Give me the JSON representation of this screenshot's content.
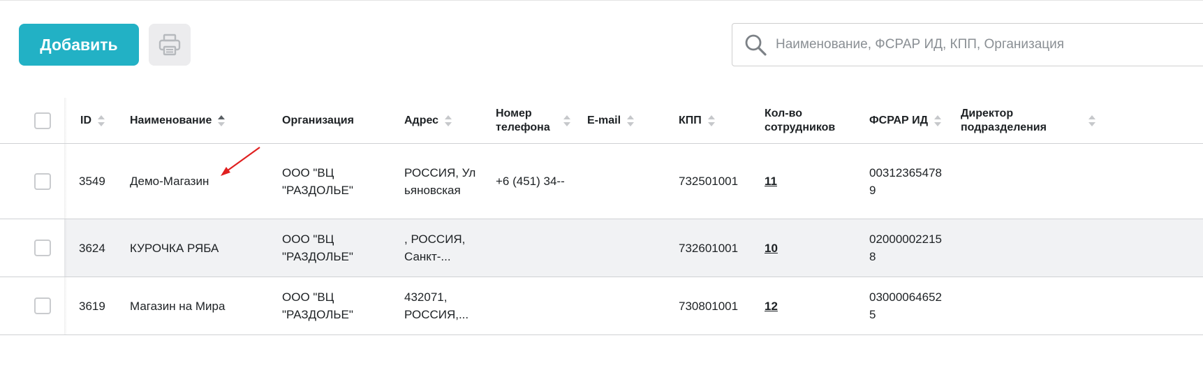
{
  "toolbar": {
    "add_label": "Добавить",
    "print_icon": "printer-icon",
    "search_icon": "search-icon",
    "search_placeholder": "Наименование, ФСРАР ИД, КПП, Организация",
    "search_value": ""
  },
  "colors": {
    "accent": "#22b1c5",
    "row_alt": "#f1f2f4",
    "annotation_arrow": "#e02020"
  },
  "table": {
    "columns": [
      {
        "label": "ID",
        "sort": "none"
      },
      {
        "label": "Наименование",
        "sort": "asc"
      },
      {
        "label": "Организация",
        "sort": ""
      },
      {
        "label": "Адрес",
        "sort": "none"
      },
      {
        "label": "Номер телефона",
        "sort": "none"
      },
      {
        "label": "E-mail",
        "sort": "none"
      },
      {
        "label": "КПП",
        "sort": "none"
      },
      {
        "label": "Кол-во сотрудников",
        "sort": ""
      },
      {
        "label": "ФСРАР ИД",
        "sort": "none"
      },
      {
        "label": "Директор подразделения",
        "sort": "none"
      }
    ],
    "rows": [
      {
        "id": "3549",
        "name": "Демо-Магазин",
        "org": "ООО \"ВЦ \"РАЗДОЛЬЕ\"",
        "address": "РОССИЯ, Ульяновская",
        "phone": "+6 (451) 34--",
        "email": "",
        "kpp": "732501001",
        "employees": "11",
        "fsrar": "003123654789",
        "director": ""
      },
      {
        "id": "3624",
        "name": "КУРОЧКА РЯБА",
        "org": "ООО \"ВЦ \"РАЗДОЛЬЕ\"",
        "address": ", РОССИЯ, Санкт-...",
        "phone": "",
        "email": "",
        "kpp": "732601001",
        "employees": "10",
        "fsrar": "020000022158",
        "director": ""
      },
      {
        "id": "3619",
        "name": "Магазин на Мира",
        "org": "ООО \"ВЦ \"РАЗДОЛЬЕ\"",
        "address": "432071, РОССИЯ,...",
        "phone": "",
        "email": "",
        "kpp": "730801001",
        "employees": "12",
        "fsrar": "030000646525",
        "director": ""
      }
    ]
  }
}
